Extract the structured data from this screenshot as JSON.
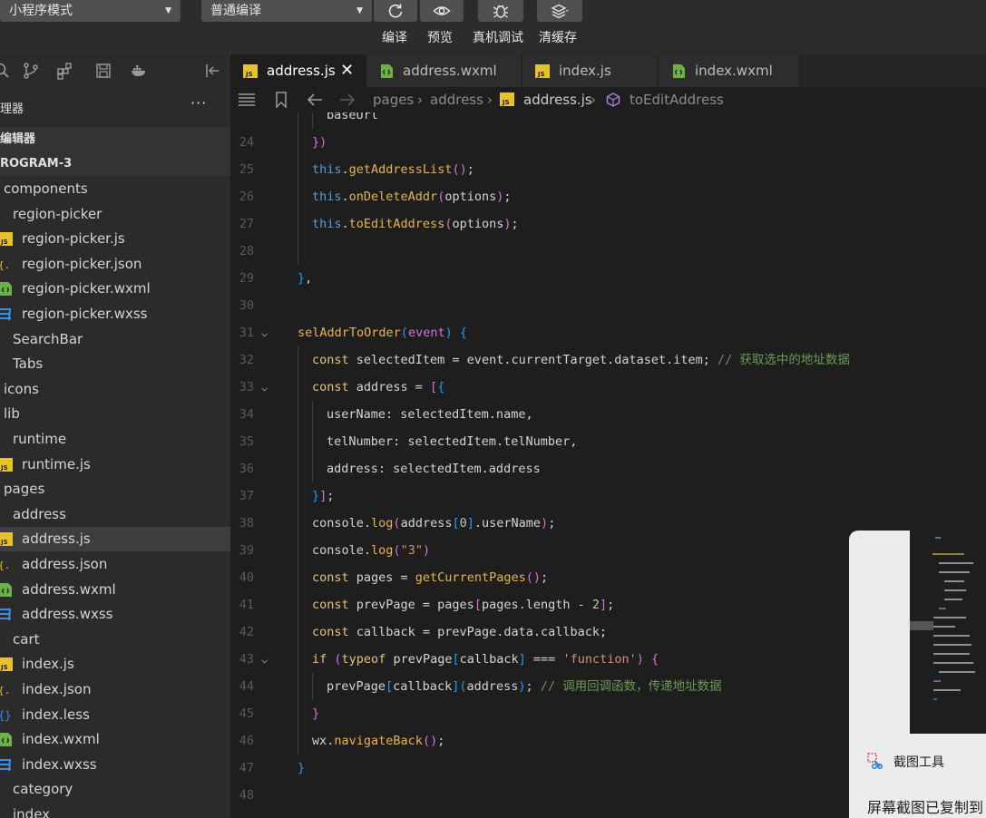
{
  "toolbar": {
    "mode_select": "小程序模式",
    "compile_select": "普通编译",
    "labels": {
      "compile": "编译",
      "preview": "预览",
      "remote_debug": "真机调试",
      "clear_cache": "清缓存"
    }
  },
  "explorer": {
    "title": "理器",
    "more": "···",
    "open_editors": "编辑器",
    "project": "ROGRAM-3",
    "tree": [
      {
        "label": "components",
        "type": "folder"
      },
      {
        "label": "region-picker",
        "type": "folder"
      },
      {
        "label": "region-picker.js",
        "type": "js"
      },
      {
        "label": "region-picker.json",
        "type": "json"
      },
      {
        "label": "region-picker.wxml",
        "type": "wxml"
      },
      {
        "label": "region-picker.wxss",
        "type": "wxss"
      },
      {
        "label": "SearchBar",
        "type": "folder"
      },
      {
        "label": "Tabs",
        "type": "folder"
      },
      {
        "label": "icons",
        "type": "folder"
      },
      {
        "label": "lib",
        "type": "folder"
      },
      {
        "label": "runtime",
        "type": "folder"
      },
      {
        "label": "runtime.js",
        "type": "js"
      },
      {
        "label": "pages",
        "type": "folder"
      },
      {
        "label": "address",
        "type": "folder"
      },
      {
        "label": "address.js",
        "type": "js",
        "selected": true
      },
      {
        "label": "address.json",
        "type": "json"
      },
      {
        "label": "address.wxml",
        "type": "wxml"
      },
      {
        "label": "address.wxss",
        "type": "wxss"
      },
      {
        "label": "cart",
        "type": "folder"
      },
      {
        "label": "index.js",
        "type": "js"
      },
      {
        "label": "index.json",
        "type": "json"
      },
      {
        "label": "index.less",
        "type": "less"
      },
      {
        "label": "index.wxml",
        "type": "wxml"
      },
      {
        "label": "index.wxss",
        "type": "wxss"
      },
      {
        "label": "category",
        "type": "folder"
      },
      {
        "label": "index",
        "type": "folder"
      }
    ]
  },
  "tabs": [
    {
      "label": "address.js",
      "type": "js",
      "active": true,
      "close": "✕"
    },
    {
      "label": "address.wxml",
      "type": "wxml"
    },
    {
      "label": "index.js",
      "type": "js"
    },
    {
      "label": "index.wxml",
      "type": "wxml"
    }
  ],
  "breadcrumb": {
    "items": [
      "pages",
      "address",
      "address.js",
      "toEditAddress"
    ]
  },
  "code": {
    "lines": [
      {
        "n": "",
        "indent": 2,
        "html": "<span class='prop'>baseUrl</span>"
      },
      {
        "n": "24",
        "indent": 1,
        "html": "<span class='br2'>})</span>"
      },
      {
        "n": "25",
        "indent": 1,
        "html": "<span class='k'>this</span>.<span class='fn'>getAddressList</span><span class='br2'>()</span>;"
      },
      {
        "n": "26",
        "indent": 1,
        "html": "<span class='k'>this</span>.<span class='fn'>onDeleteAddr</span><span class='br2'>(</span>options<span class='br2'>)</span>;"
      },
      {
        "n": "27",
        "indent": 1,
        "html": "<span class='k'>this</span>.<span class='fn'>toEditAddress</span><span class='br2'>(</span>options<span class='br2'>)</span>;"
      },
      {
        "n": "28",
        "indent": 1,
        "html": ""
      },
      {
        "n": "29",
        "indent": 0,
        "html": "<span class='br3'>}</span>,"
      },
      {
        "n": "30",
        "indent": 0,
        "html": ""
      },
      {
        "n": "31",
        "indent": 0,
        "fold": true,
        "html": "<span class='fn'>selAddrToOrder</span><span class='br3'>(</span><span class='br2'>event</span><span class='br3'>)</span> <span class='br3'>{</span>"
      },
      {
        "n": "32",
        "indent": 1,
        "html": "<span class='kw'>const</span> selectedItem = event.currentTarget.dataset.item; <span class='cm'>// 获取选中的地址数据</span>"
      },
      {
        "n": "33",
        "indent": 1,
        "fold": true,
        "html": "<span class='kw'>const</span> address = <span class='br2'>[</span><span class='br3'>{</span>"
      },
      {
        "n": "34",
        "indent": 2,
        "html": "userName: selectedItem.name,"
      },
      {
        "n": "35",
        "indent": 2,
        "html": "telNumber: selectedItem.telNumber,"
      },
      {
        "n": "36",
        "indent": 2,
        "html": "address: selectedItem.address"
      },
      {
        "n": "37",
        "indent": 1,
        "html": "<span class='br3'>}</span><span class='br2'>]</span>;"
      },
      {
        "n": "38",
        "indent": 1,
        "html": "console.<span class='fn'>log</span><span class='br2'>(</span>address<span class='br3'>[</span><span class='num'>0</span><span class='br3'>]</span>.userName<span class='br2'>)</span>;"
      },
      {
        "n": "39",
        "indent": 1,
        "html": "console.<span class='fn'>log</span><span class='br2'>(</span><span class='str'>\"3\"</span><span class='br2'>)</span>"
      },
      {
        "n": "40",
        "indent": 1,
        "html": "<span class='kw'>const</span> pages = <span class='fn'>getCurrentPages</span><span class='br2'>()</span>;"
      },
      {
        "n": "41",
        "indent": 1,
        "html": "<span class='kw'>const</span> prevPage = pages<span class='br2'>[</span>pages.length - <span class='num'>2</span><span class='br2'>]</span>;"
      },
      {
        "n": "42",
        "indent": 1,
        "html": "<span class='kw'>const</span> callback = prevPage.data.callback;"
      },
      {
        "n": "43",
        "indent": 1,
        "fold": true,
        "html": "<span class='kw'>if</span> <span class='br2'>(</span><span class='kw'>typeof</span> prevPage<span class='br3'>[</span>callback<span class='br3'>]</span> === <span class='str'>'function'</span><span class='br2'>)</span> <span class='br2'>{</span>"
      },
      {
        "n": "44",
        "indent": 2,
        "html": "prevPage<span class='br3'>[</span>callback<span class='br3'>]</span><span class='br3'>(</span>address<span class='br3'>)</span>; <span class='cm'>// 调用回调函数，传递地址数据</span>"
      },
      {
        "n": "45",
        "indent": 1,
        "html": "<span class='br2'>}</span>"
      },
      {
        "n": "46",
        "indent": 1,
        "html": "wx.<span class='fn'>navigateBack</span><span class='br2'>()</span>;"
      },
      {
        "n": "47",
        "indent": 0,
        "html": "<span class='br3'>}</span>"
      },
      {
        "n": "48",
        "indent": 0,
        "html": ""
      }
    ]
  },
  "popup": {
    "app_name": "截图工具",
    "message": "屏幕截图已复制到"
  },
  "colors": {
    "toolbar_bg": "#2c2c2c",
    "sidebar_bg": "#2b2b2b",
    "editor_bg": "#1e1e1e",
    "js_icon": "#e8c22a",
    "wxml_icon": "#6cb04a",
    "wxss_icon": "#3a8ee6"
  }
}
